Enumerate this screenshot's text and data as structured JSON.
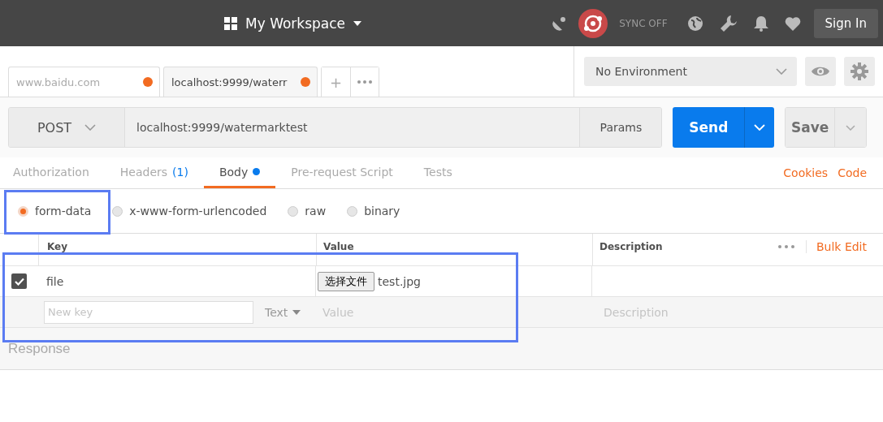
{
  "header": {
    "workspace": "My Workspace",
    "sync": "SYNC OFF",
    "sign_in": "Sign In"
  },
  "tabs": [
    {
      "label": "www.baidu.com",
      "selected": false,
      "unsaved": true
    },
    {
      "label": "localhost:9999/waterr",
      "selected": true,
      "unsaved": true
    }
  ],
  "new_tab": "+",
  "environment": {
    "value": "No Environment"
  },
  "request": {
    "method": "POST",
    "url": "localhost:9999/watermarktest",
    "params": "Params",
    "send": "Send",
    "save": "Save"
  },
  "request_tabs": [
    {
      "label": "Authorization",
      "selected": false
    },
    {
      "label": "Headers",
      "count": "(1)",
      "selected": false
    },
    {
      "label": "Body",
      "selected": true,
      "dot": true
    },
    {
      "label": "Pre-request Script",
      "selected": false
    },
    {
      "label": "Tests",
      "selected": false
    }
  ],
  "links": [
    "Cookies",
    "Code"
  ],
  "body_modes": [
    {
      "label": "form-data",
      "selected": true
    },
    {
      "label": "x-www-form-urlencoded",
      "selected": false
    },
    {
      "label": "raw",
      "selected": false
    },
    {
      "label": "binary",
      "selected": false
    }
  ],
  "table": {
    "columns": [
      "Key",
      "Value",
      "Description"
    ],
    "bulk_edit": "Bulk Edit",
    "rows": [
      {
        "checked": true,
        "key": "file",
        "file_button": "选择文件",
        "file_name": "test.jpg"
      }
    ],
    "new_row": {
      "key_placeholder": "New key",
      "type": "Text",
      "value_placeholder": "Value",
      "description_placeholder": "Description"
    }
  },
  "response": {
    "title": "Response"
  }
}
